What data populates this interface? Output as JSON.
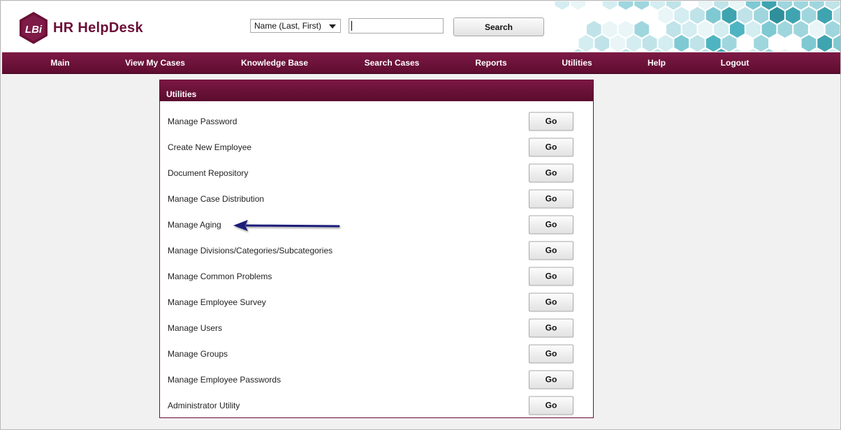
{
  "app": {
    "logo_text": "LBi",
    "title": "HR HelpDesk"
  },
  "search": {
    "select_value": "Name (Last, First)",
    "input_value": "",
    "button_label": "Search"
  },
  "nav": {
    "items": [
      "Main",
      "View My Cases",
      "Knowledge Base",
      "Search Cases",
      "Reports",
      "Utilities",
      "Help",
      "Logout"
    ]
  },
  "panel": {
    "title": "Utilities",
    "go_label": "Go",
    "rows": [
      "Manage Password",
      "Create New Employee",
      "Document Repository",
      "Manage Case Distribution",
      "Manage Aging",
      "Manage Divisions/Categories/Subcategories",
      "Manage Common Problems",
      "Manage Employee Survey",
      "Manage Users",
      "Manage Groups",
      "Manage Employee Passwords",
      "Administrator Utility"
    ]
  },
  "annotation": {
    "arrow_target": "Manage Aging",
    "arrow_color": "#1a1a7a"
  },
  "colors": {
    "brand": "#6b0f36",
    "nav_bg": "#6e1239",
    "hex_teal": "#4fb4c1",
    "hex_light": "#bfe3e8"
  }
}
